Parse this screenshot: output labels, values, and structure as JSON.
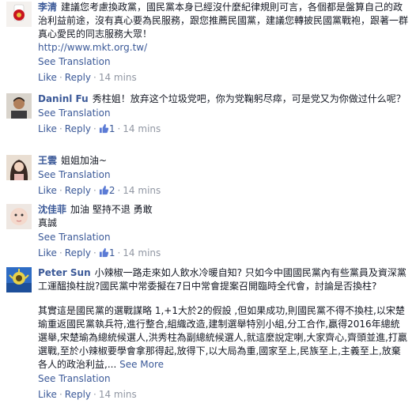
{
  "comments": [
    {
      "author": "李清",
      "text": "建議您考慮換政黨，國民黨本身已經沒什麼紀律規則可言，各個都是盤算自己的政治利益前途，沒有真心要為民服務，跟您推薦民國黨，建議您轉披民國黨戰袍，跟著一群真心愛民的同志服務大眾！",
      "link": "http://www.mkt.org.tw/",
      "translate": "See Translation",
      "like": "Like",
      "reply": "Reply",
      "likes": "",
      "time": "14 mins"
    },
    {
      "author": "Daninl Fu",
      "text": "秀柱姐！放弃这个垃圾党吧，你为党鞠躬尽瘁，可是党又为你做过什么呢？",
      "translate": "See Translation",
      "like": "Like",
      "reply": "Reply",
      "likes": "1",
      "time": "14 mins"
    },
    {
      "author": "王雲",
      "text": "姐姐加油~",
      "translate": "See Translation",
      "like": "Like",
      "reply": "Reply",
      "likes": "2",
      "time": "14 mins"
    },
    {
      "author": "沈佳菲",
      "text": "加油 堅持不退 勇敢真誠",
      "translate": "See Translation",
      "like": "Like",
      "reply": "Reply",
      "likes": "1",
      "time": "14 mins"
    },
    {
      "author": "Peter Sun",
      "text": "小辣椒一路走來如人飲水冷暖自知? 只如今中國國民黨內有些黨員及資深黨工運醞換柱說?國民黨中常委擬在7日中常會提案召開臨時全代會，討論是否換柱?",
      "text2": "其實這是國民黨的選戰謀略 1,+1大於2的假設 ,但如果成功,則國民黨不得不換柱,以宋楚瑜重返國民黨執兵符,進行整合,組織改造,建制選舉特別小組,分工合作,贏得2016年總統選舉,宋楚瑜為總統候選人,洪秀柱為副總統候選人,就這麼說定喇,大家齊心,齊頭並進,打贏選戰,至於小辣椒要學會拿那得起,放得下,以大局為重,國家至上,民族至上,主義至上,放棄各人的政治利益,...",
      "see_more": "See More",
      "translate": "See Translation",
      "like": "Like",
      "reply": "Reply",
      "likes": "",
      "time": "14 mins"
    }
  ]
}
